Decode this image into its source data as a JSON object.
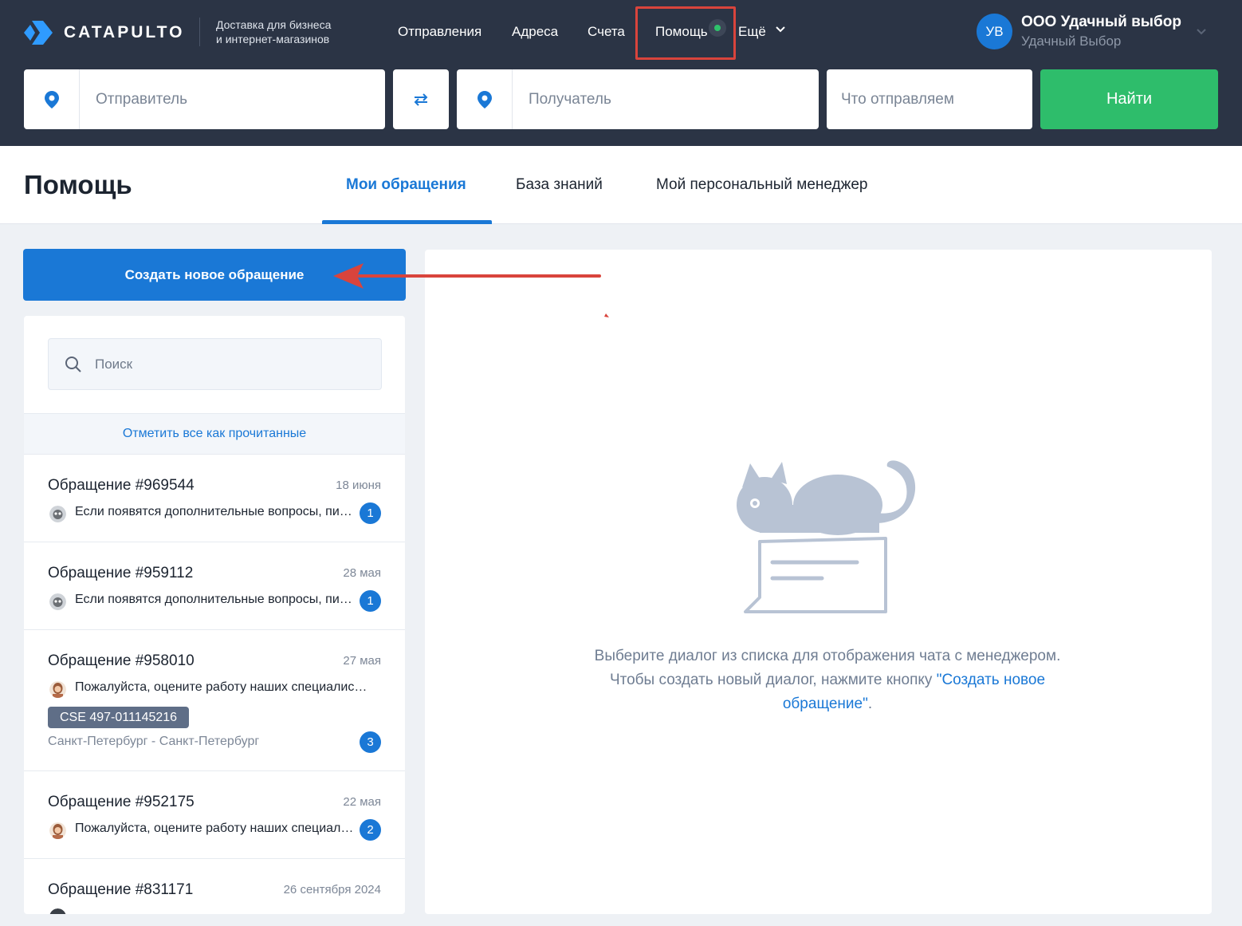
{
  "header": {
    "logo_text": "CATAPULTO",
    "tagline_line1": "Доставка для бизнеса",
    "tagline_line2": "и интернет-магазинов",
    "nav": {
      "shipments": "Отправления",
      "addresses": "Адреса",
      "invoices": "Счета",
      "help": "Помощь",
      "more": "Ещё"
    },
    "user": {
      "initials": "УВ",
      "company": "ООО Удачный выбор",
      "subtitle": "Удачный Выбор"
    }
  },
  "search": {
    "sender_placeholder": "Отправитель",
    "recipient_placeholder": "Получатель",
    "cargo_placeholder": "Что отправляем",
    "find_label": "Найти"
  },
  "help_page": {
    "title": "Помощь",
    "tabs": {
      "my_requests": "Мои обращения",
      "knowledge_base": "База знаний",
      "personal_manager": "Мой персональный менеджер"
    },
    "active_tab": "my_requests"
  },
  "sidebar": {
    "create_label": "Создать новое обращение",
    "search_placeholder": "Поиск",
    "mark_all_read": "Отметить все как прочитанные",
    "tickets": [
      {
        "title": "Обращение #969544",
        "date": "18 июня",
        "message": "Если появятся дополнительные вопросы, пишите нам",
        "unread": "1"
      },
      {
        "title": "Обращение #959112",
        "date": "28 мая",
        "message": "Если появятся дополнительные вопросы, пишите нам",
        "unread": "1"
      },
      {
        "title": "Обращение #958010",
        "date": "27 мая",
        "message": "Пожалуйста, оцените работу наших специалистов",
        "tag": "CSE 497-011145216",
        "route": "Санкт-Петербург - Санкт-Петербург",
        "unread": "3"
      },
      {
        "title": "Обращение #952175",
        "date": "22 мая",
        "message": "Пожалуйста, оцените работу наших специалистов",
        "unread": "2"
      },
      {
        "title": "Обращение #831171",
        "date": "26 сентября 2024"
      }
    ]
  },
  "chat": {
    "empty_text_before": "Выберите диалог из списка для отображения чата с менеджером. Чтобы создать новый диалог, нажмите кнопку ",
    "empty_link": "\"Создать новое обращение\"",
    "empty_text_after": "."
  },
  "colors": {
    "header_bg": "#2b3445",
    "accent": "#1a78d6",
    "find_button": "#2ebd6b",
    "annotation": "#d9443c",
    "online_dot": "#2ec26b"
  }
}
